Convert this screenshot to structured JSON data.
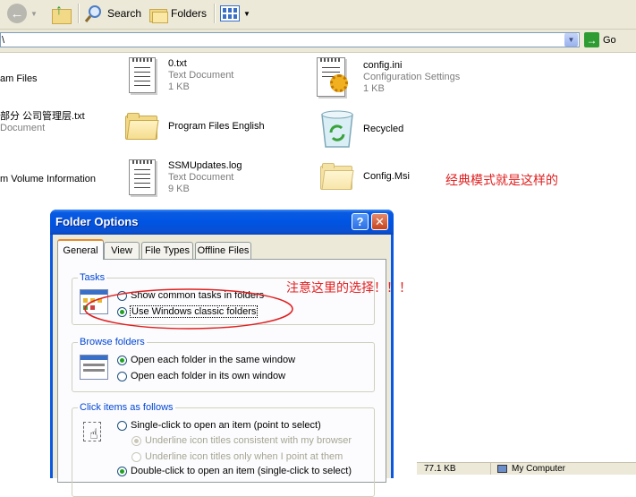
{
  "toolbar": {
    "search_label": "Search",
    "folders_label": "Folders"
  },
  "address": {
    "value": "\\",
    "go_label": "Go"
  },
  "files": [
    {
      "name": "am Files",
      "sub1": "",
      "sub2": "",
      "icon": "folder-icon"
    },
    {
      "name": "0.txt",
      "sub1": "Text Document",
      "sub2": "1 KB",
      "icon": "text-document-icon"
    },
    {
      "name": "config.ini",
      "sub1": "Configuration Settings",
      "sub2": "1 KB",
      "icon": "config-settings-icon"
    },
    {
      "name": "部分  公司管理层.txt",
      "sub1": "Document",
      "sub2": "",
      "icon": "text-document-icon"
    },
    {
      "name": "Program Files English",
      "sub1": "",
      "sub2": "",
      "icon": "folder-icon"
    },
    {
      "name": "Recycled",
      "sub1": "",
      "sub2": "",
      "icon": "recycle-bin-icon"
    },
    {
      "name": "m Volume Information",
      "sub1": "",
      "sub2": "",
      "icon": "folder-icon"
    },
    {
      "name": "SSMUpdates.log",
      "sub1": "Text Document",
      "sub2": "9 KB",
      "icon": "text-document-icon"
    },
    {
      "name": "Config.Msi",
      "sub1": "",
      "sub2": "",
      "icon": "folder-icon"
    }
  ],
  "annotations": {
    "classic_note": "经典模式就是这样的",
    "choice_note": "注意这里的选择！！！"
  },
  "status": {
    "size": "77.1 KB",
    "location": "My Computer"
  },
  "dialog": {
    "title": "Folder Options",
    "help_glyph": "?",
    "close_glyph": "✕",
    "tabs": [
      "General",
      "View",
      "File Types",
      "Offline Files"
    ],
    "tasks": {
      "label": "Tasks",
      "opt1": "Show common tasks in folders",
      "opt2": "Use Windows classic folders"
    },
    "browse": {
      "label": "Browse folders",
      "opt1": "Open each folder in the same window",
      "opt2": "Open each folder in its own window"
    },
    "click": {
      "label": "Click items as follows",
      "opt1": "Single-click to open an item (point to select)",
      "opt1a": "Underline icon titles consistent with my browser",
      "opt1b": "Underline icon titles only when I point at them",
      "opt2": "Double-click to open an item (single-click to select)"
    }
  },
  "colors": {
    "annotation": "#e02020",
    "xp_title_blue": "#0054e3",
    "group_label": "#0046d5"
  }
}
